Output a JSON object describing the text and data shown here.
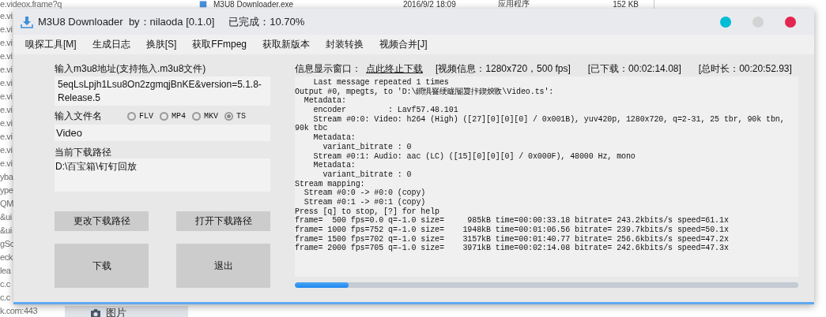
{
  "background": {
    "file_row": {
      "name": "M3U8 Downloader.exe",
      "modified": "2016/9/2 18:09",
      "type": "应用程序",
      "size": "152 KB"
    },
    "side_list": [
      {
        "text": "e.videox.frame?q"
      },
      {
        "text": "e.vi"
      },
      {
        "text": "e.vi"
      },
      {
        "text": "e.vi"
      },
      {
        "text": "e.vi"
      },
      {
        "text": "e.vi"
      },
      {
        "text": "e.vi"
      },
      {
        "text": "e.vi"
      },
      {
        "text": "e.vi"
      },
      {
        "text": "e.vi"
      },
      {
        "text": "e.vi"
      },
      {
        "text": "e.vi"
      },
      {
        "text": "e.vi"
      },
      {
        "text": "yba"
      },
      {
        "text": "ype"
      },
      {
        "text": "QM"
      },
      {
        "text": "&ui"
      },
      {
        "text": "&ui"
      },
      {
        "text": "gSc"
      },
      {
        "text": "eck"
      },
      {
        "text": "lea"
      },
      {
        "text": "c.c"
      },
      {
        "text": "c.c"
      },
      {
        "text": "k.com:443"
      }
    ],
    "bottom_tab": {
      "label": "图片"
    }
  },
  "window": {
    "title": "M3U8 Downloader  by：nilaoda [0.1.0]",
    "status": "已完成：10.70%"
  },
  "menu": [
    "嗅探工具[M]",
    "生成日志",
    "换肤[S]",
    "获取FFmpeg",
    "获取新版本",
    "封装转换",
    "视频合并[J]"
  ],
  "url": {
    "label": "输入m3u8地址(支持拖入.m3u8文件)",
    "value": "5eqLsLpjh1Lsu8On2zgmqjBnKE&version=5.1.8-Release.5"
  },
  "filename": {
    "label": "输入文件名",
    "formats": [
      {
        "label": "FLV",
        "selected": false
      },
      {
        "label": "MP4",
        "selected": false
      },
      {
        "label": "MKV",
        "selected": false
      },
      {
        "label": "TS",
        "selected": true
      }
    ],
    "value": "Video"
  },
  "path": {
    "label": "当前下载路径",
    "value": "D:\\百宝箱\\钉钉回放"
  },
  "buttons": [
    {
      "label": "更改下载路径",
      "kind": "small"
    },
    {
      "label": "打开下载路径",
      "kind": "small"
    },
    {
      "label": "下载",
      "kind": "large"
    },
    {
      "label": "退出",
      "kind": "large"
    }
  ],
  "info": {
    "label": "信息显示窗口：",
    "stop_link": "点此终止下载",
    "video_info": "[视频信息：1280x720，500 fps]",
    "downloaded": "[已下载：00:02:14.08]",
    "duration": "[总时长：00:20:52.93]"
  },
  "log": [
    "    Last message repeated 1 times",
    "Output #0, mpegts, to 'D:\\鐧惧疂绠眬閽夐拤鍥炴斁\\Video.ts':",
    "  Metadata:",
    "    encoder         : Lavf57.48.101",
    "    Stream #0:0: Video: h264 (High) ([27][0][0][0] / 0x001B), yuv420p, 1280x720, q=2-31, 25 tbr, 90k tbn,",
    "90k tbc",
    "    Metadata:",
    "      variant_bitrate : 0",
    "    Stream #0:1: Audio: aac (LC) ([15][0][0][0] / 0x000F), 48000 Hz, mono",
    "    Metadata:",
    "      variant_bitrate : 0",
    "Stream mapping:",
    "  Stream #0:0 -> #0:0 (copy)",
    "  Stream #0:1 -> #0:1 (copy)",
    "Press [q] to stop, [?] for help",
    "frame=  500 fps=0.0 q=-1.0 size=     985kB time=00:00:33.18 bitrate= 243.2kbits/s speed=61.1x",
    "frame= 1000 fps=752 q=-1.0 size=    1948kB time=00:01:06.56 bitrate= 239.7kbits/s speed=50.1x",
    "frame= 1500 fps=702 q=-1.0 size=    3157kB time=00:01:40.77 bitrate= 256.6kbits/s speed=47.2x",
    "frame= 2000 fps=705 q=-1.0 size=    3971kB time=00:02:14.08 bitrate= 242.6kbits/s speed=47.3x"
  ],
  "progress": {
    "level": 0.107
  }
}
